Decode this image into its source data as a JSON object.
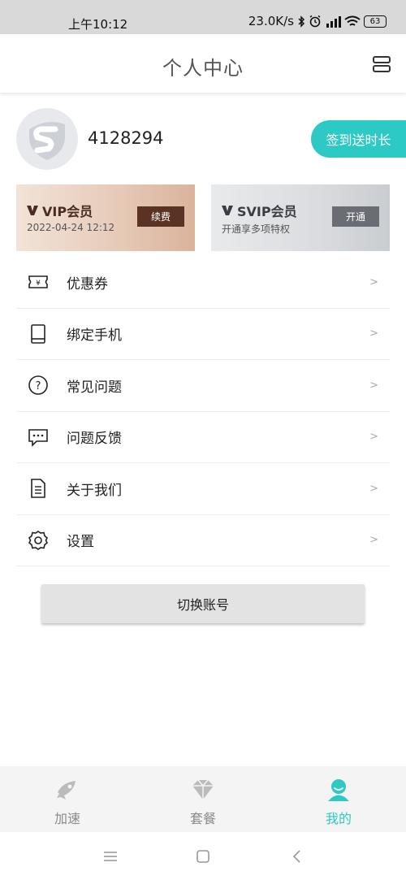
{
  "status_bar": {
    "time": "上午10:12",
    "network_speed": "23.0K/s",
    "battery": "63"
  },
  "header": {
    "title": "个人中心"
  },
  "profile": {
    "user_id": "4128294",
    "checkin_label": "签到送时长"
  },
  "vip_card": {
    "title": "VIP会员",
    "subtitle": "2022-04-24 12:12",
    "button": "续费"
  },
  "svip_card": {
    "title": "SVIP会员",
    "subtitle": "开通享多项特权",
    "button": "开通"
  },
  "menu": {
    "items": [
      {
        "label": "优惠券",
        "icon": "coupon-icon"
      },
      {
        "label": "绑定手机",
        "icon": "phone-icon"
      },
      {
        "label": "常见问题",
        "icon": "question-icon"
      },
      {
        "label": "问题反馈",
        "icon": "feedback-icon"
      },
      {
        "label": "关于我们",
        "icon": "document-icon"
      },
      {
        "label": "设置",
        "icon": "gear-icon"
      }
    ],
    "arrow": ">"
  },
  "switch_account_label": "切换账号",
  "tabs": [
    {
      "label": "加速",
      "icon": "rocket-fish-icon"
    },
    {
      "label": "套餐",
      "icon": "diamond-icon"
    },
    {
      "label": "我的",
      "icon": "user-icon",
      "active": true
    }
  ],
  "colors": {
    "accent": "#2dc9c4",
    "vip_button": "#5a3324",
    "svip_button": "#6a6d73"
  }
}
